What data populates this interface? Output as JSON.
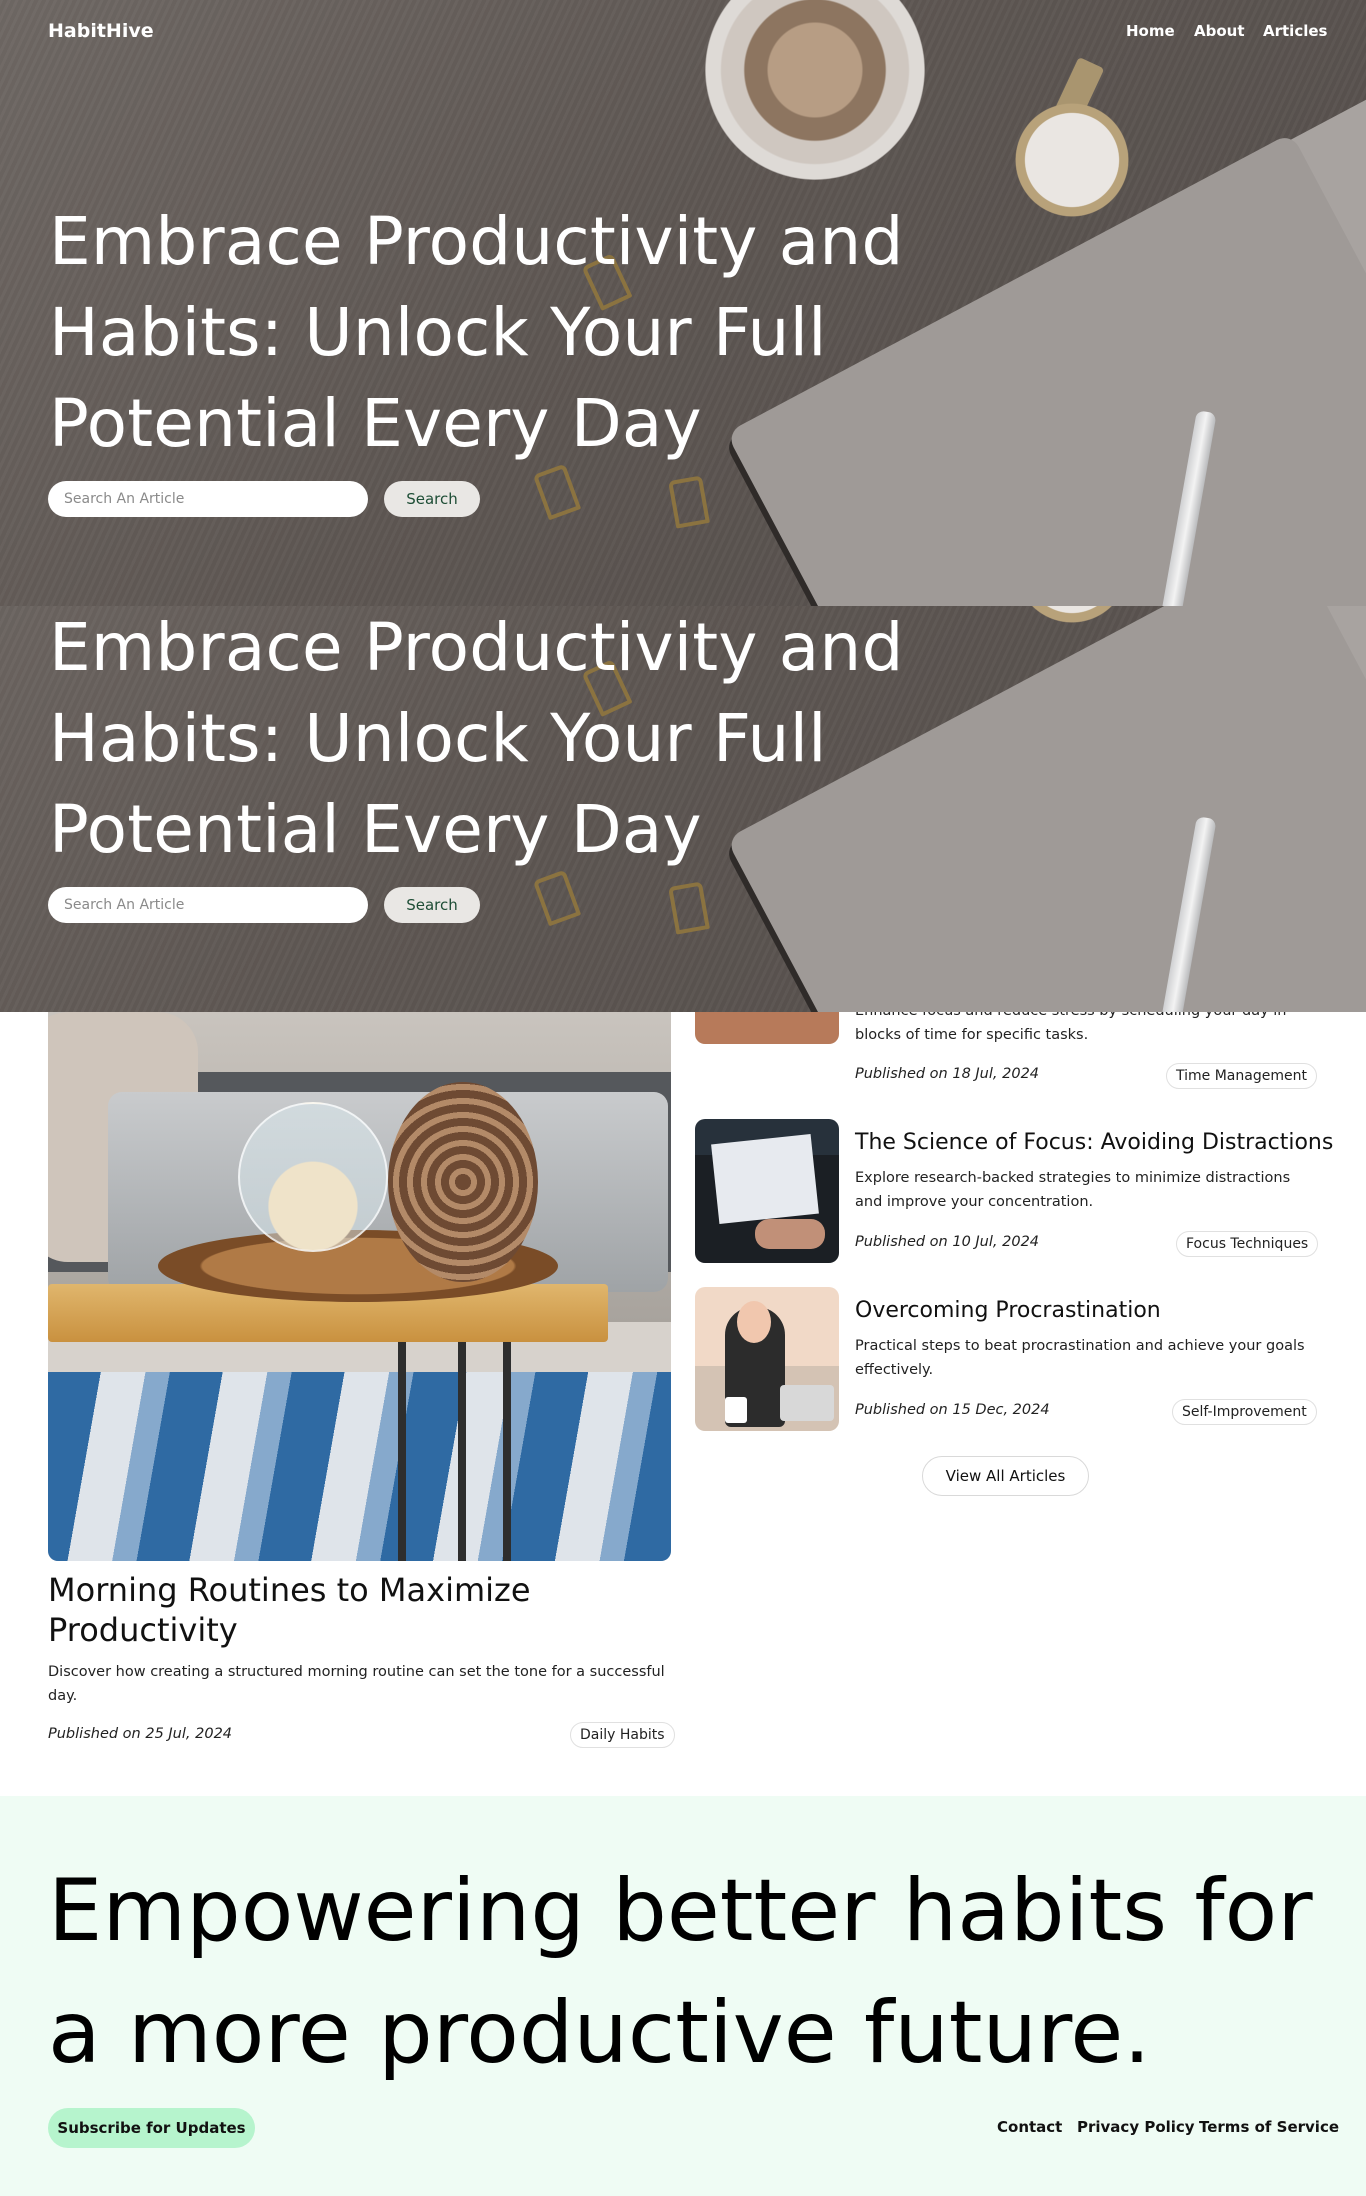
{
  "brand": "HabitHive",
  "nav": {
    "home": "Home",
    "about": "About",
    "articles": "Articles"
  },
  "hero": {
    "title": "Embrace Productivity and Habits: Unlock Your Full Potential Every Day",
    "search_placeholder": "Search An Article",
    "search_label": "Search"
  },
  "featured": {
    "title": "Morning Routines to Maximize Productivity",
    "description": "Discover how creating a structured morning routine can set the tone for a successful day.",
    "published": "Published on 25 Jul, 2024",
    "tag": "Daily Habits"
  },
  "articles": [
    {
      "title": "",
      "description": "Enhance focus and reduce stress by scheduling your day in blocks of time for specific tasks.",
      "published": "Published on 18 Jul, 2024",
      "tag": "Time Management"
    },
    {
      "title": "The Science of Focus: Avoiding Distractions",
      "description": "Explore research-backed strategies to minimize distractions and improve your concentration.",
      "published": "Published on 10 Jul, 2024",
      "tag": "Focus Techniques"
    },
    {
      "title": "Overcoming Procrastination",
      "description": "Practical steps to beat procrastination and achieve your goals effectively.",
      "published": "Published on 15 Dec, 2024",
      "tag": "Self-Improvement"
    }
  ],
  "view_all": "View All Articles",
  "footer": {
    "title": "Empowering better habits for a more productive future.",
    "subscribe": "Subscribe for Updates",
    "links": {
      "contact": "Contact",
      "privacy": "Privacy Policy",
      "terms": "Terms of Service"
    }
  },
  "colors": {
    "accent_green": "#b6f4cd",
    "footer_bg": "#effcf4",
    "search_text": "#1d4d35"
  },
  "icons": {}
}
